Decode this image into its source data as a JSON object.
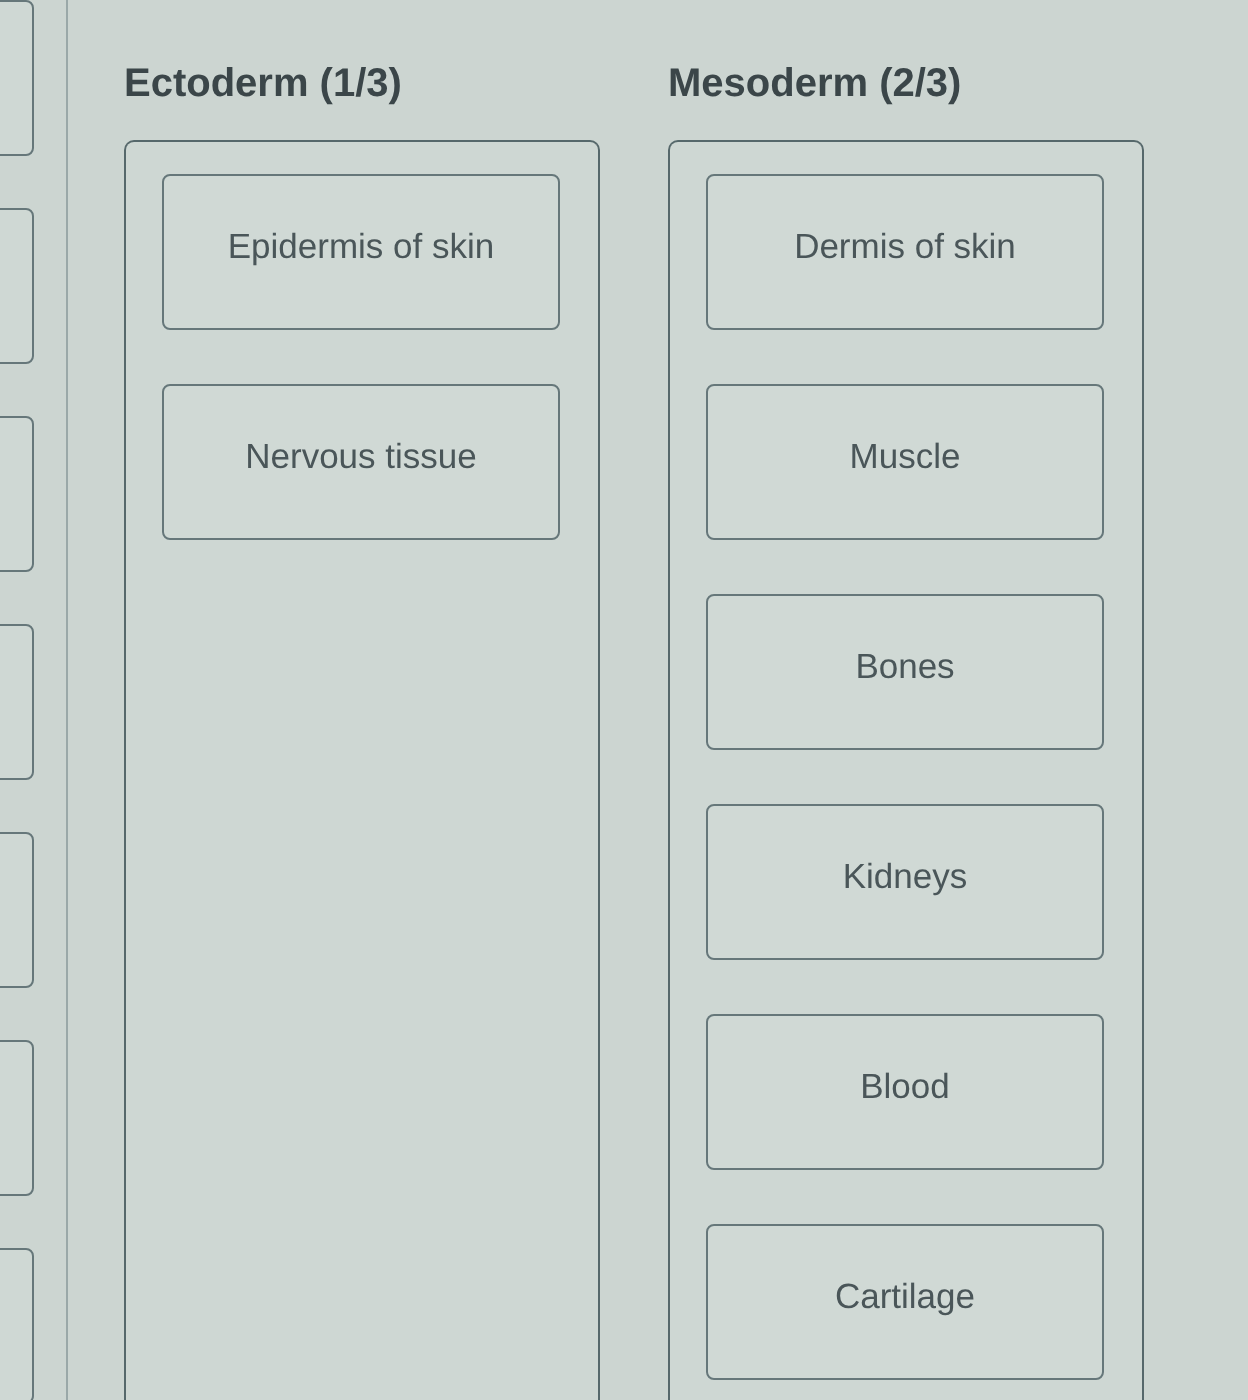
{
  "left_cards": [
    {
      "kind": "blank"
    },
    {
      "kind": "blank"
    },
    {
      "kind": "blank"
    },
    {
      "kind": "blank"
    },
    {
      "kind": "blank"
    },
    {
      "kind": "blank"
    },
    {
      "kind": "blank"
    }
  ],
  "columns": [
    {
      "heading": "Ectoderm (1/3)",
      "cards": [
        "Epidermis of skin",
        "Nervous tissue"
      ]
    },
    {
      "heading": "Mesoderm (2/3)",
      "cards": [
        "Dermis of skin",
        "Muscle",
        "Bones",
        "Kidneys",
        "Blood",
        "Cartilage"
      ]
    }
  ]
}
